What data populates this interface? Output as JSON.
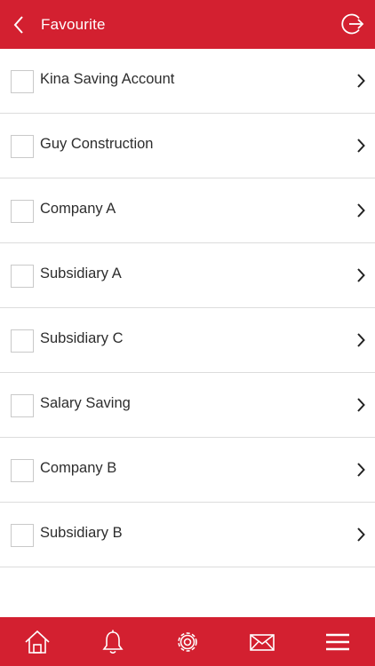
{
  "header": {
    "title": "Favourite",
    "back_icon": "chevron-left-icon",
    "logout_icon": "logout-icon"
  },
  "favourites": {
    "items": [
      {
        "label": "Kina Saving Account",
        "checked": false
      },
      {
        "label": "Guy Construction",
        "checked": false
      },
      {
        "label": "Company A",
        "checked": false
      },
      {
        "label": "Subsidiary A",
        "checked": false
      },
      {
        "label": "Subsidiary C",
        "checked": false
      },
      {
        "label": "Salary Saving",
        "checked": false
      },
      {
        "label": "Company B",
        "checked": false
      },
      {
        "label": "Subsidiary B",
        "checked": false
      }
    ]
  },
  "bottom_nav": {
    "items": [
      "home-icon",
      "bell-icon",
      "gear-icon",
      "envelope-icon",
      "menu-icon"
    ]
  },
  "colors": {
    "brand": "#d32030",
    "divider": "#dcdcdc",
    "text": "#2d2d2d"
  }
}
